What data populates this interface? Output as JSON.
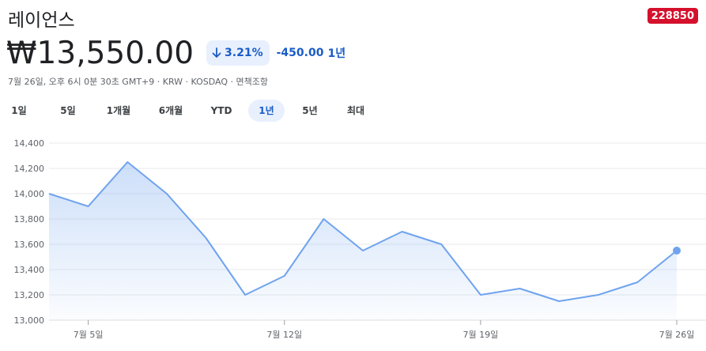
{
  "header": {
    "company_name": "레이언스",
    "ticker_code": "228850"
  },
  "quote": {
    "price": "₩13,550.00",
    "change_percent": "3.21%",
    "change_absolute": "-450.00",
    "change_period": "1년",
    "meta": "7월 26일, 오후 6시 0분 30초 GMT+9 · KRW · KOSDAQ · 면책조항"
  },
  "tabs": [
    {
      "label": "1일",
      "active": false
    },
    {
      "label": "5일",
      "active": false
    },
    {
      "label": "1개월",
      "active": false
    },
    {
      "label": "6개월",
      "active": false
    },
    {
      "label": "YTD",
      "active": false
    },
    {
      "label": "1년",
      "active": true
    },
    {
      "label": "5년",
      "active": false
    },
    {
      "label": "최대",
      "active": false
    }
  ],
  "colors": {
    "line": "#6fa3ee",
    "accent": "#1a5cc8",
    "badge": "#d5102c"
  },
  "icons": {
    "change_direction": "arrow-down-icon"
  },
  "chart_data": {
    "type": "area",
    "ylim": [
      13000,
      14400
    ],
    "yticks": [
      13000,
      13200,
      13400,
      13600,
      13800,
      14000,
      14200,
      14400
    ],
    "ytick_labels": [
      "13,000",
      "13,200",
      "13,400",
      "13,600",
      "13,800",
      "14,000",
      "14,200",
      "14,400"
    ],
    "x_tick_labels": [
      "7월 5일",
      "7월 12일",
      "7월 19일",
      "7월 26일"
    ],
    "x_tick_index": [
      1,
      6,
      11,
      16
    ],
    "values": [
      14000,
      13900,
      14250,
      14000,
      13650,
      13200,
      13350,
      13800,
      13550,
      13700,
      13600,
      13200,
      13250,
      13150,
      13200,
      13300,
      13550
    ],
    "grid": true,
    "legend": "none"
  }
}
